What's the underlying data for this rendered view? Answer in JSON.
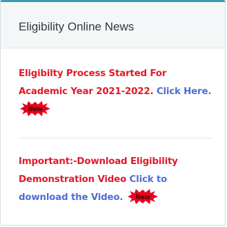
{
  "panel": {
    "title": "Eligibility Online News"
  },
  "news": [
    {
      "text": "Eligibilty Process Started For Academic Year 2021-2022.",
      "link_text": "Click Here.",
      "badge": "New"
    },
    {
      "text": "Important:-Download Eligibility Demonstration Video",
      "link_text": "Click to download the Video.",
      "badge": "New"
    }
  ],
  "colors": {
    "accent_border": "#3a9bb0",
    "news_red": "#e01a2b",
    "link_blue": "#4f6fd8",
    "badge_red": "#e8001c"
  },
  "icons": {
    "badge": "new-starburst-icon"
  }
}
